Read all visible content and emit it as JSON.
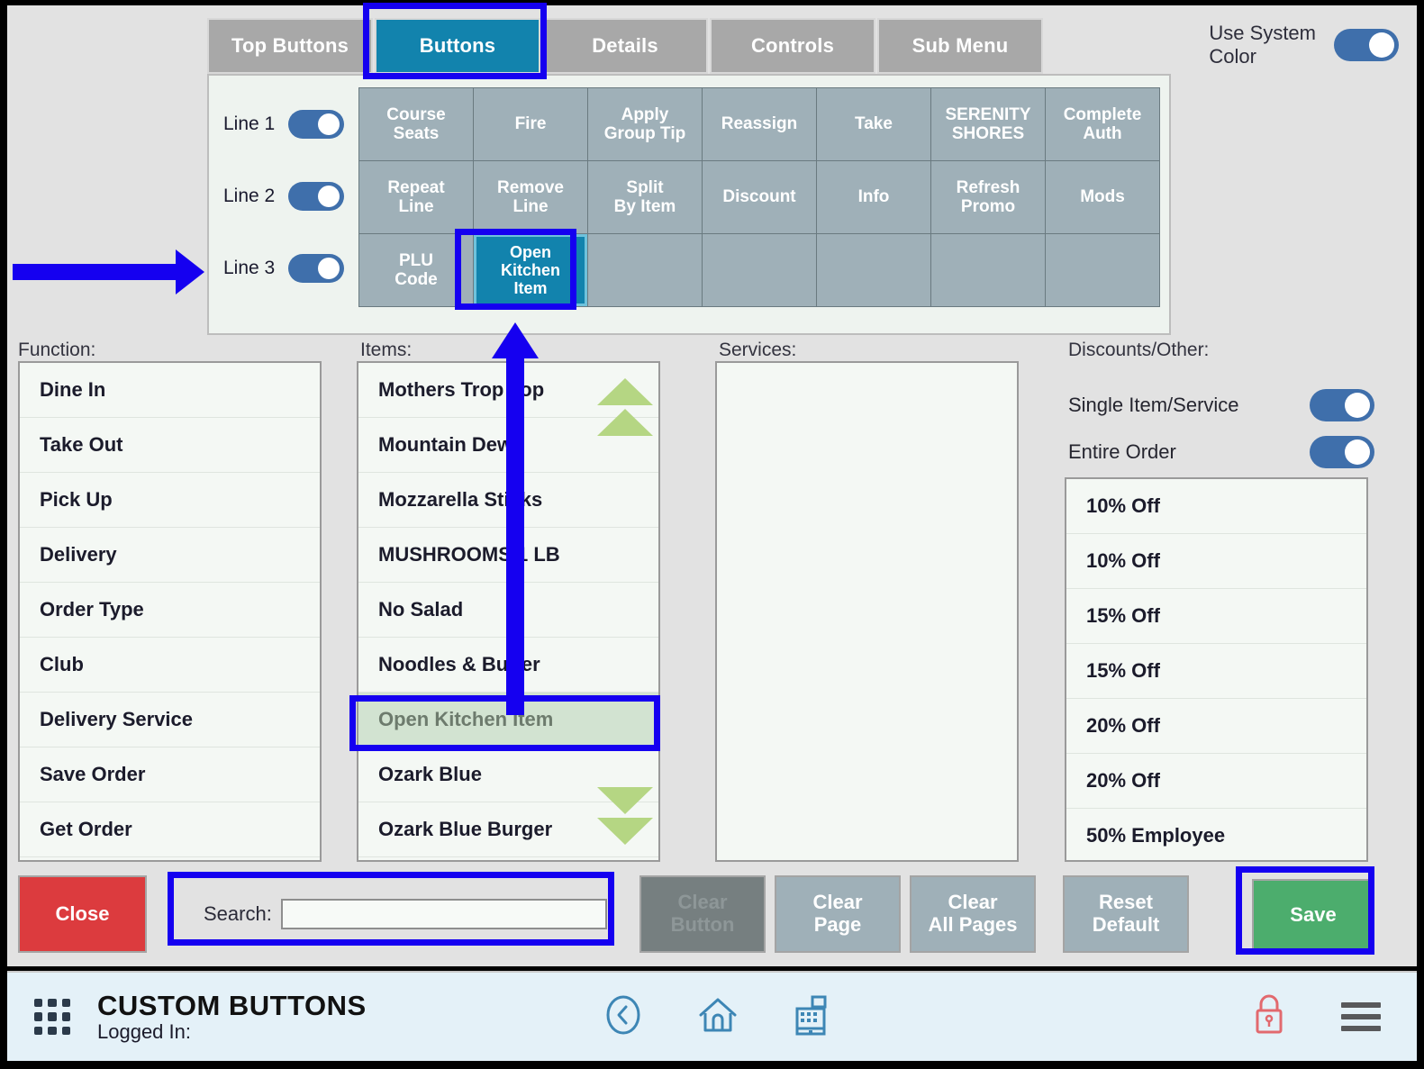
{
  "window": {
    "use_system_color_label": "Use System\nColor",
    "use_system_color_line1": "Use System",
    "use_system_color_line2": "Color",
    "use_system_color_on": true
  },
  "tabs": [
    {
      "label": "Top Buttons",
      "active": false
    },
    {
      "label": "Buttons",
      "active": true
    },
    {
      "label": "Details",
      "active": false
    },
    {
      "label": "Controls",
      "active": false
    },
    {
      "label": "Sub Menu",
      "active": false
    }
  ],
  "designer": {
    "lines": [
      {
        "label": "Line 1",
        "on": true
      },
      {
        "label": "Line 2",
        "on": true
      },
      {
        "label": "Line 3",
        "on": true
      }
    ],
    "grid": [
      [
        {
          "label": "Course\nSeats",
          "l1": "Course",
          "l2": "Seats",
          "selected": false
        },
        {
          "label": "Fire",
          "l1": "Fire",
          "l2": "",
          "selected": false
        },
        {
          "label": "Apply\nGroup Tip",
          "l1": "Apply",
          "l2": "Group Tip",
          "selected": false
        },
        {
          "label": "Reassign",
          "l1": "Reassign",
          "l2": "",
          "selected": false
        },
        {
          "label": "Take",
          "l1": "Take",
          "l2": "",
          "selected": false
        },
        {
          "label": "SERENITY\nSHORES",
          "l1": "SERENITY",
          "l2": "SHORES",
          "selected": false
        },
        {
          "label": "Complete\nAuth",
          "l1": "Complete",
          "l2": "Auth",
          "selected": false
        }
      ],
      [
        {
          "label": "Repeat\nLine",
          "l1": "Repeat",
          "l2": "Line",
          "selected": false
        },
        {
          "label": "Remove\nLine",
          "l1": "Remove",
          "l2": "Line",
          "selected": false
        },
        {
          "label": "Split\nBy Item",
          "l1": "Split",
          "l2": "By Item",
          "selected": false
        },
        {
          "label": "Discount",
          "l1": "Discount",
          "l2": "",
          "selected": false
        },
        {
          "label": "Info",
          "l1": "Info",
          "l2": "",
          "selected": false
        },
        {
          "label": "Refresh\nPromo",
          "l1": "Refresh",
          "l2": "Promo",
          "selected": false
        },
        {
          "label": "Mods",
          "l1": "Mods",
          "l2": "",
          "selected": false
        }
      ],
      [
        {
          "label": "PLU\nCode",
          "l1": "PLU",
          "l2": "Code",
          "selected": false
        },
        {
          "label": "Open\nKitchen\nItem",
          "l1": "Open",
          "l2": "Kitchen",
          "l3": "Item",
          "selected": true
        },
        {
          "label": "",
          "l1": "",
          "l2": "",
          "selected": false
        },
        {
          "label": "",
          "l1": "",
          "l2": "",
          "selected": false
        },
        {
          "label": "",
          "l1": "",
          "l2": "",
          "selected": false
        },
        {
          "label": "",
          "l1": "",
          "l2": "",
          "selected": false
        },
        {
          "label": "",
          "l1": "",
          "l2": "",
          "selected": false
        }
      ]
    ]
  },
  "panels": {
    "function": {
      "title": "Function:",
      "items": [
        "Dine In",
        "Take Out",
        "Pick Up",
        "Delivery",
        "Order Type",
        "Club",
        "Delivery Service",
        "Save Order",
        "Get Order"
      ]
    },
    "items": {
      "title": "Items:",
      "selected_index": 6,
      "items": [
        "Mothers Trop Top",
        "Mountain Dew",
        "Mozzarella Sticks",
        "MUSHROOMS 1 LB",
        "No Salad",
        "Noodles & Butter",
        "Open Kitchen Item",
        "Ozark Blue",
        "Ozark Blue Burger"
      ]
    },
    "services": {
      "title": "Services:",
      "items": []
    },
    "discounts": {
      "title": "Discounts/Other:",
      "single_item_label": "Single Item/Service",
      "single_item_on": true,
      "entire_order_label": "Entire Order",
      "entire_order_on": true,
      "items": [
        "10% Off",
        "10% Off",
        "15% Off",
        "15% Off",
        "20% Off",
        "20% Off",
        "50% Employee"
      ]
    }
  },
  "actions": {
    "close": "Close",
    "search_label": "Search:",
    "search_value": "",
    "search_placeholder": "",
    "clear_button_l1": "Clear",
    "clear_button_l2": "Button",
    "clear_page_l1": "Clear",
    "clear_page_l2": "Page",
    "clear_all_l1": "Clear",
    "clear_all_l2": "All Pages",
    "reset_l1": "Reset",
    "reset_l2": "Default",
    "save": "Save"
  },
  "footer": {
    "title": "CUSTOM BUTTONS",
    "logged_in": "Logged In:",
    "icons": [
      "grid-icon",
      "back-circle-icon",
      "home-icon",
      "register-icon",
      "lock-icon",
      "hamburger-menu-icon"
    ]
  },
  "colors": {
    "accent_blue": "#1283ad",
    "annotation_blue": "#1500f0",
    "toggle_blue": "#3f6fab",
    "button_gray": "#9fb0b8",
    "close_red": "#dc3b3e",
    "save_green": "#4cad6d",
    "list_select_green": "#d2e3d1",
    "scroll_arrow_green": "#b5d683",
    "footer_bg": "#e4f1f8",
    "lock_red": "#e2696e"
  }
}
